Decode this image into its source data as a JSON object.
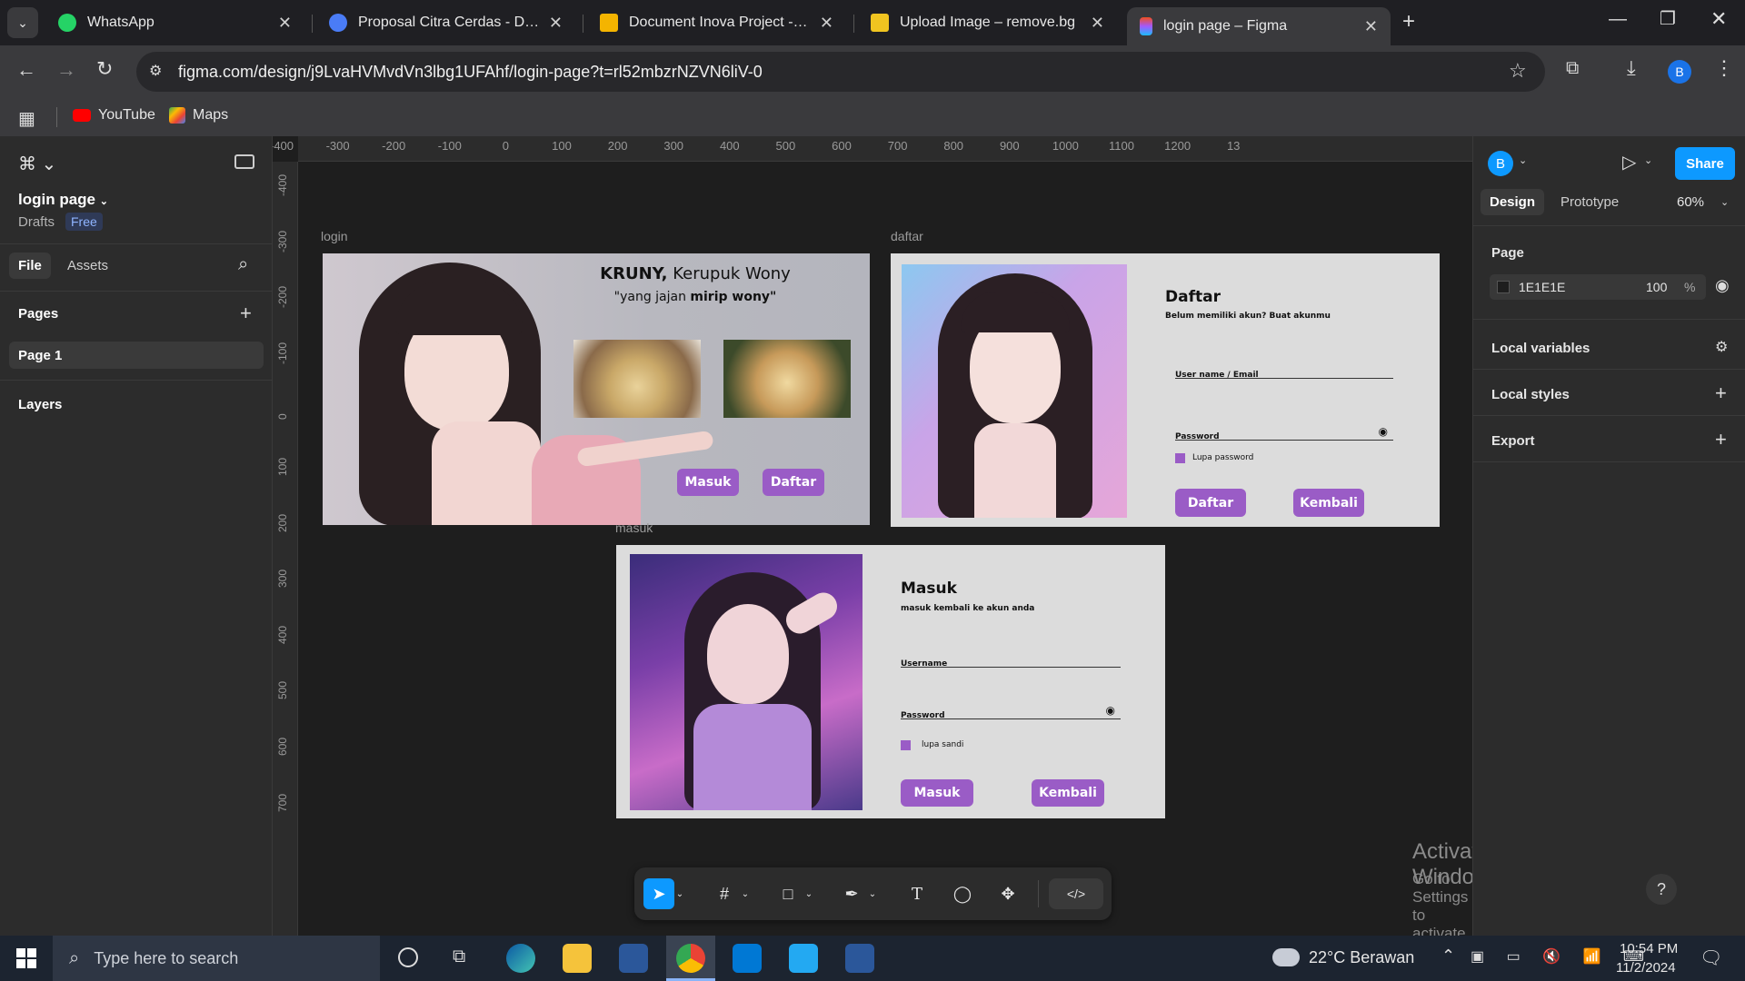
{
  "browser": {
    "tabs": [
      {
        "label": "WhatsApp",
        "color": "#25D366"
      },
      {
        "label": "Proposal Citra Cerdas - Dokume",
        "color": "#4a7cf6"
      },
      {
        "label": "Document Inova Project - Goog",
        "color": "#f4b400"
      },
      {
        "label": "Upload Image – remove.bg",
        "color": "#f0c420"
      },
      {
        "label": "login page – Figma",
        "color": "#f24e1e"
      }
    ],
    "url": "figma.com/design/j9LvaHVMvdVn3lbg1UFAhf/login-page?t=rl52mbzrNZVN6liV-0",
    "bookmarks": [
      "YouTube",
      "Maps"
    ],
    "profile_initial": "B"
  },
  "left_panel": {
    "file_name": "login page",
    "location": "Drafts",
    "plan_badge": "Free",
    "tabs": [
      "File",
      "Assets"
    ],
    "pages_heading": "Pages",
    "pages": [
      "Page 1"
    ],
    "layers_heading": "Layers"
  },
  "right_panel": {
    "user_initial": "B",
    "share_label": "Share",
    "tabs": [
      "Design",
      "Prototype"
    ],
    "zoom": "60%",
    "page_heading": "Page",
    "page_color_hex": "1E1E1E",
    "page_opacity": "100",
    "percent_sign": "%",
    "sections": [
      "Local variables",
      "Local styles",
      "Export"
    ]
  },
  "rulers": {
    "top": [
      "-400",
      "-300",
      "-200",
      "-100",
      "0",
      "100",
      "200",
      "300",
      "400",
      "500",
      "600",
      "700",
      "800",
      "900",
      "1000",
      "1100",
      "1200",
      "13"
    ],
    "left": [
      "-400",
      "-300",
      "-200",
      "-100",
      "0",
      "100",
      "200",
      "300",
      "400",
      "500",
      "600",
      "700"
    ]
  },
  "frames": {
    "login": {
      "label": "login",
      "brand": "KRUNY,",
      "brand_rest": " Kerupuk Wony",
      "tagline_pre": "\"yang jajan ",
      "tagline_bold": "mirip wony\"",
      "btn_masuk": "Masuk",
      "btn_daftar": "Daftar"
    },
    "daftar": {
      "label": "daftar",
      "title": "Daftar",
      "subtitle": "Belum memiliki akun? Buat akunmu",
      "field_user": "User name / Email",
      "field_password": "Password",
      "checkbox": "Lupa password",
      "btn_daftar": "Daftar",
      "btn_kembali": "Kembali"
    },
    "masuk": {
      "label": "masuk",
      "title": "Masuk",
      "subtitle": "masuk kembali ke akun anda",
      "field_user": "Username",
      "field_password": "Password",
      "checkbox": "lupa sandi",
      "btn_masuk": "Masuk",
      "btn_kembali": "Kembali"
    }
  },
  "watermark": {
    "title": "Activate Windows",
    "subtitle": "Go to Settings to activate Windows."
  },
  "taskbar": {
    "search_placeholder": "Type here to search",
    "weather": "22°C  Berawan",
    "time": "10:54 PM",
    "date": "11/2/2024"
  },
  "colors": {
    "accent_purple": "#9a5cc6",
    "figma_blue": "#0d99ff"
  }
}
